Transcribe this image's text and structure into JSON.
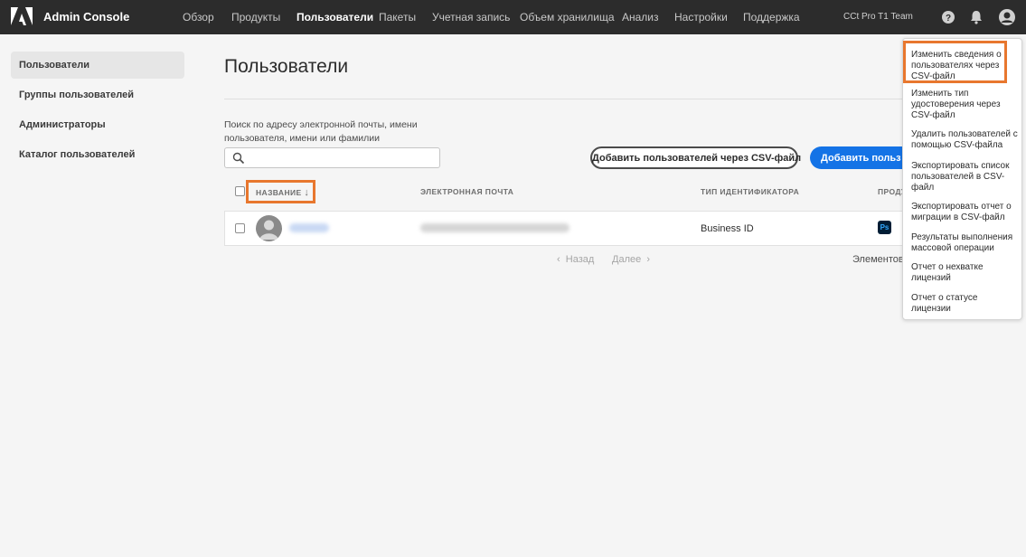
{
  "header": {
    "app_title": "Admin Console",
    "nav": [
      "Обзор",
      "Продукты",
      "Пользователи",
      "Пакеты",
      "Учетная запись",
      "Объем хранилища",
      "Анализ",
      "Настройки",
      "Поддержка"
    ],
    "active_nav": "Пользователи",
    "org_name": "CCt Pro T1 Team",
    "icons": [
      "help-icon",
      "bell-icon",
      "profile-icon"
    ]
  },
  "sidebar": {
    "items": [
      "Пользователи",
      "Группы пользователей",
      "Администраторы",
      "Каталог пользователей"
    ],
    "active": "Пользователи"
  },
  "main": {
    "title": "Пользователи",
    "search_label": "Поиск по адресу электронной почты, имени пользователя, имени или фамилии",
    "search_value": "",
    "add_csv_button": "Добавить пользователей через CSV-файл",
    "add_button": "Добавить польз",
    "table": {
      "columns": [
        "НАЗВАНИЕ",
        "ЭЛЕКТРОННАЯ ПОЧТА",
        "ТИП ИДЕНТИФИКАТОРА",
        "ПРОДУ"
      ],
      "sort_indicator": "↓",
      "rows": [
        {
          "id_type": "Business ID",
          "product": "Ps"
        }
      ]
    },
    "pager": {
      "prev": "Назад",
      "next": "Далее",
      "items_label": "Элементов н"
    }
  },
  "menu": {
    "items": [
      "Изменить сведения о пользователях через CSV-файл",
      "Изменить тип удостоверения через CSV-файл",
      "Удалить пользователей с помощью CSV-файла",
      "Экспортировать список пользователей в CSV-файл",
      "Экспортировать отчет о миграции в CSV-файл",
      "Результаты выполнения массовой операции",
      "Отчет о нехватке лицензий",
      "Отчет о статусе лицензии"
    ]
  },
  "colors": {
    "topbar": "#2c2c2c",
    "primary": "#1473e6",
    "highlight": "#e8772e",
    "photoshop_bg": "#001e36",
    "photoshop_fg": "#31a8ff"
  }
}
